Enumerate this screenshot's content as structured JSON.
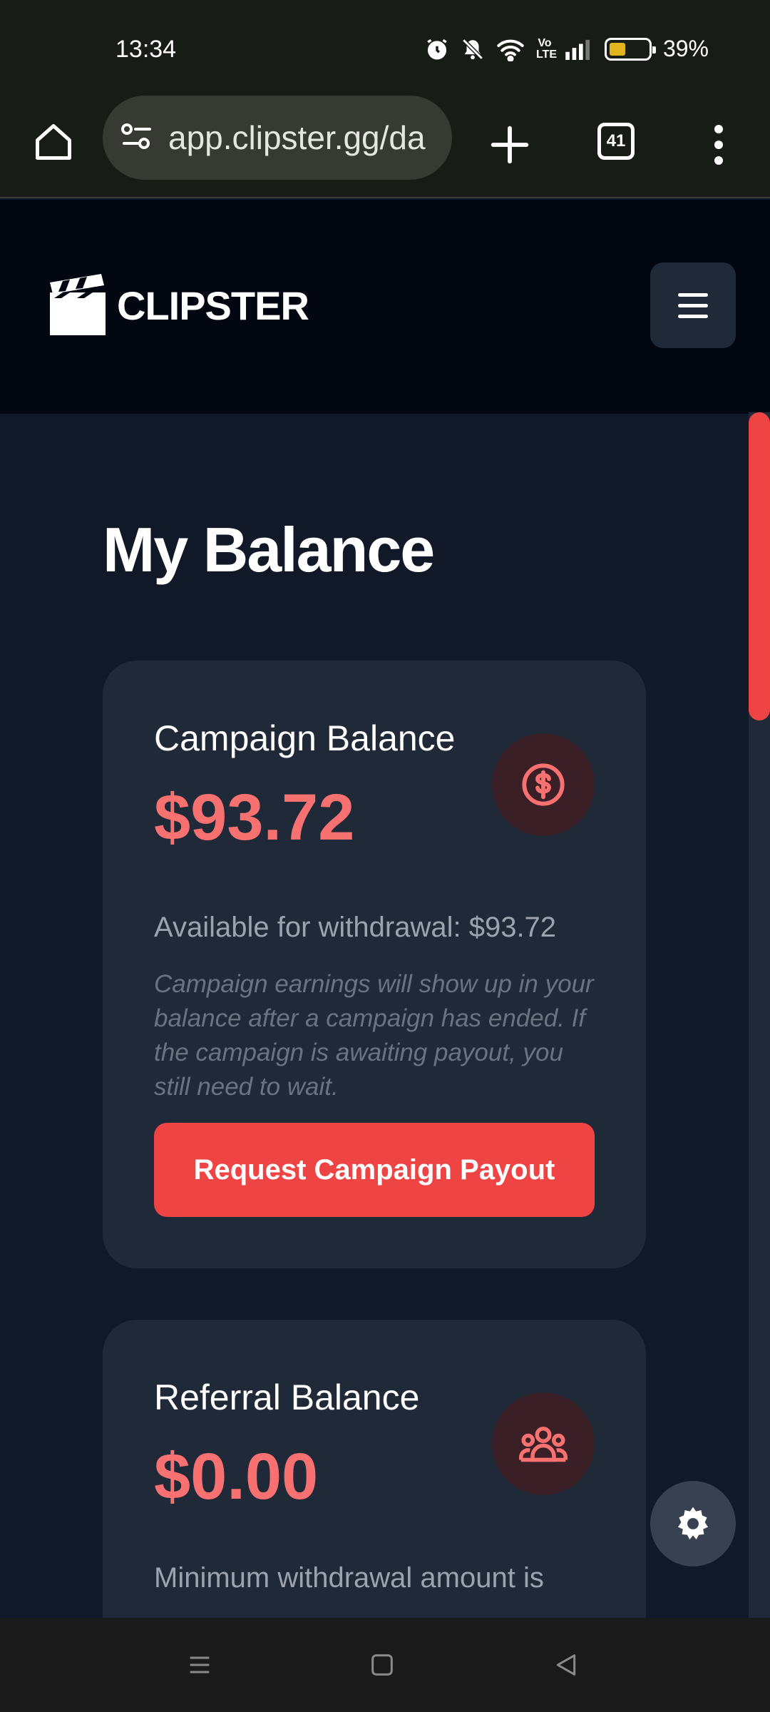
{
  "status_bar": {
    "time": "13:34",
    "battery_percent": "39%",
    "battery_level": 0.39,
    "icons": [
      "alarm-icon",
      "bell-muted-icon",
      "wifi-icon",
      "volte-icon",
      "signal-icon",
      "battery-icon"
    ]
  },
  "browser": {
    "url": "app.clipster.gg/da",
    "tab_count": "41"
  },
  "site": {
    "brand": "CLIPSTER"
  },
  "page": {
    "title": "My Balance"
  },
  "campaign_card": {
    "label": "Campaign Balance",
    "amount": "$93.72",
    "available": "Available for withdrawal: $93.72",
    "note": "Campaign earnings will show up in your balance after a campaign has ended. If the campaign is awaiting payout, you still need to wait.",
    "button": "Request Campaign Payout",
    "icon": "dollar-icon"
  },
  "referral_card": {
    "label": "Referral Balance",
    "amount": "$0.00",
    "sub": "Minimum withdrawal amount is",
    "icon": "users-icon"
  },
  "colors": {
    "accent": "#ef4444",
    "amount": "#f87171",
    "card": "#1f2937",
    "background": "#111827",
    "header": "#030712"
  }
}
